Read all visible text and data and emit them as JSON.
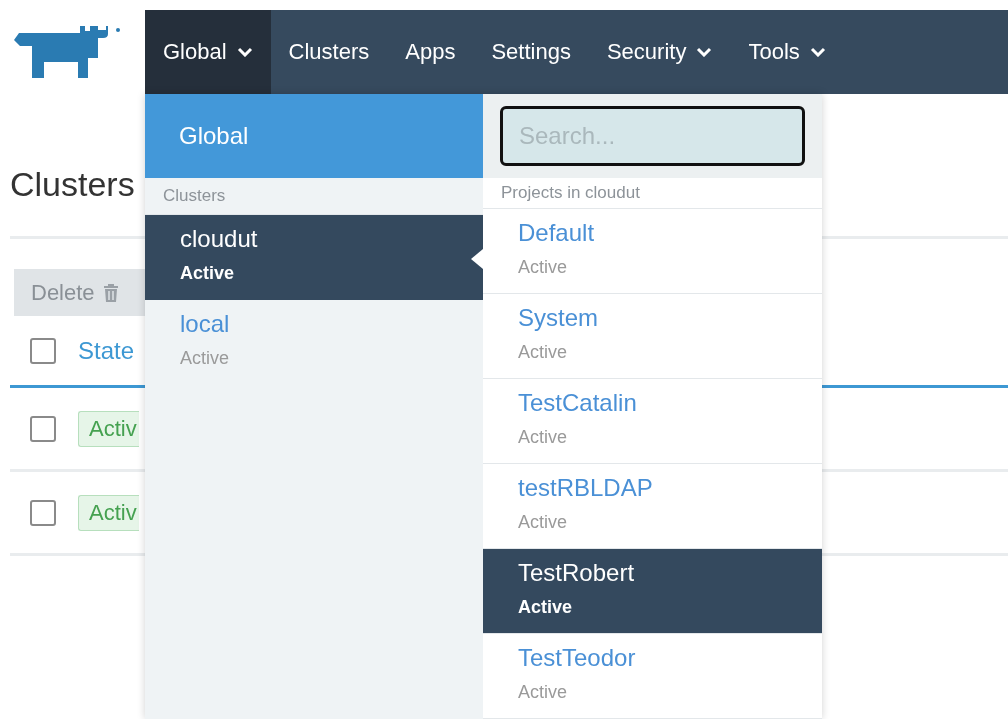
{
  "nav": [
    {
      "label": "Global",
      "selected": true,
      "dropdown": true
    },
    {
      "label": "Clusters",
      "selected": false,
      "dropdown": false
    },
    {
      "label": "Apps",
      "selected": false,
      "dropdown": false
    },
    {
      "label": "Settings",
      "selected": false,
      "dropdown": false
    },
    {
      "label": "Security",
      "selected": false,
      "dropdown": true
    },
    {
      "label": "Tools",
      "selected": false,
      "dropdown": true
    }
  ],
  "page": {
    "title": "Clusters",
    "delete_button": "Delete",
    "header_checked": false,
    "columns": [
      "State"
    ],
    "rows": [
      {
        "checked": false,
        "state": "Activ"
      },
      {
        "checked": false,
        "state": "Activ"
      }
    ]
  },
  "switcher": {
    "global": "Global",
    "clusters_header": "Clusters",
    "clusters": [
      {
        "name": "cloudut",
        "status": "Active",
        "selected": true
      },
      {
        "name": "local",
        "status": "Active",
        "selected": false
      }
    ],
    "search": {
      "placeholder": "Search..."
    },
    "projects_header": "Projects in cloudut",
    "projects": [
      {
        "name": "Default",
        "status": "Active",
        "selected": false
      },
      {
        "name": "System",
        "status": "Active",
        "selected": false
      },
      {
        "name": "TestCatalin",
        "status": "Active",
        "selected": false
      },
      {
        "name": "testRBLDAP",
        "status": "Active",
        "selected": false
      },
      {
        "name": "TestRobert",
        "status": "Active",
        "selected": true
      },
      {
        "name": "TestTeodor",
        "status": "Active",
        "selected": false
      }
    ]
  }
}
